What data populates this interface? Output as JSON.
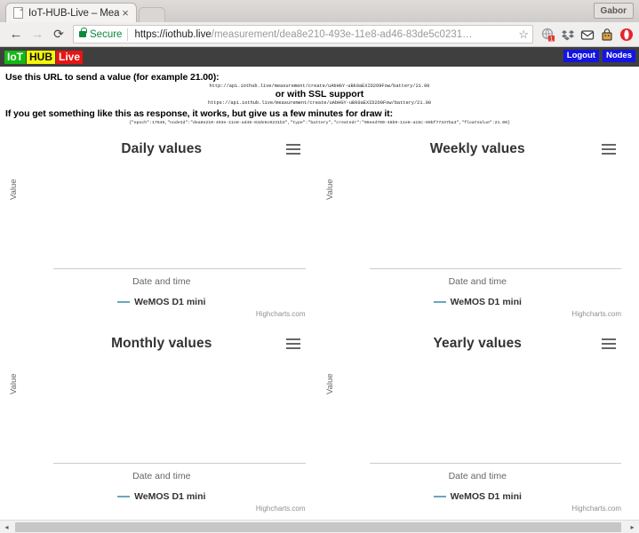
{
  "browser": {
    "tab": {
      "title": "IoT-HUB-Live – Measu",
      "close_label": "×",
      "favicon_name": "page-icon"
    },
    "new_tab_label": "",
    "profile_label": "Gabor",
    "nav": {
      "back": "←",
      "forward": "→",
      "reload": "⟳"
    },
    "omnibox": {
      "security_label": "Secure",
      "url_domain": "https://iothub.live",
      "url_path": "/measurement/dea8e210-493e-11e8-ad46-83de5c0231…",
      "bookmark_star": "☆"
    },
    "extensions": [
      "shield-badge-icon",
      "dropbox-icon",
      "mail-icon",
      "lock-safe-icon",
      "opera-icon"
    ],
    "scrollbar": {
      "left_arrow": "◂",
      "right_arrow": "▸"
    }
  },
  "app": {
    "logo": {
      "part1": "IoT",
      "part2": "HUB",
      "part3": "Live",
      "color1": "#14b814",
      "color2": "#f7f70a",
      "color3": "#e81414"
    },
    "actions": {
      "logout": "Logout",
      "nodes": "Nodes",
      "color": "#1414e6"
    }
  },
  "instructions": {
    "line1": "Use this URL to send a value (for example 21.00):",
    "url_http": "http://api.iothub.live/measurement/create/uAbHGY-uBk0aEXID2O9Fow/battery/21.00",
    "ssl_note": "or with SSL support",
    "url_https": "https://api.iothub.live/measurement/create/uAbHGY-uBk0aEXID2O9Fow/battery/21.00",
    "line2": "If you get something like this as response, it works, but give us a few minutes for draw it:",
    "json_response": "{\"epoch\":17646,\"nodeId\":\"dea8e210-493e-11e8-ad46-83de5c0231b3\",\"type\":\"battery\",\"createdr\":\"06eed700-48b9-11e8-a15c-89bf77347ba3\",\"floatValue\":21.00}"
  },
  "charts": [
    {
      "title": "Daily values",
      "menu_name": "context-menu-icon",
      "credit": "Highcharts.com",
      "chart_data": {
        "type": "line",
        "title": "Daily values",
        "xlabel": "Date and time",
        "ylabel": "Value",
        "series": [
          {
            "name": "WeMOS D1 mini",
            "color": "#6aa6bd",
            "values": []
          }
        ],
        "categories": [],
        "legend_position": "bottom",
        "grid": false
      }
    },
    {
      "title": "Weekly values",
      "menu_name": "context-menu-icon",
      "credit": "Highcharts.com",
      "chart_data": {
        "type": "line",
        "title": "Weekly values",
        "xlabel": "Date and time",
        "ylabel": "Value",
        "series": [
          {
            "name": "WeMOS D1 mini",
            "color": "#6aa6bd",
            "values": []
          }
        ],
        "categories": [],
        "legend_position": "bottom",
        "grid": false
      }
    },
    {
      "title": "Monthly values",
      "menu_name": "context-menu-icon",
      "credit": "Highcharts.com",
      "chart_data": {
        "type": "line",
        "title": "Monthly values",
        "xlabel": "Date and time",
        "ylabel": "Value",
        "series": [
          {
            "name": "WeMOS D1 mini",
            "color": "#6aa6bd",
            "values": []
          }
        ],
        "categories": [],
        "legend_position": "bottom",
        "grid": false
      }
    },
    {
      "title": "Yearly values",
      "menu_name": "context-menu-icon",
      "credit": "Highcharts.com",
      "chart_data": {
        "type": "line",
        "title": "Yearly values",
        "xlabel": "Date and time",
        "ylabel": "Value",
        "series": [
          {
            "name": "WeMOS D1 mini",
            "color": "#6aa6bd",
            "values": []
          }
        ],
        "categories": [],
        "legend_position": "bottom",
        "grid": false
      }
    }
  ]
}
